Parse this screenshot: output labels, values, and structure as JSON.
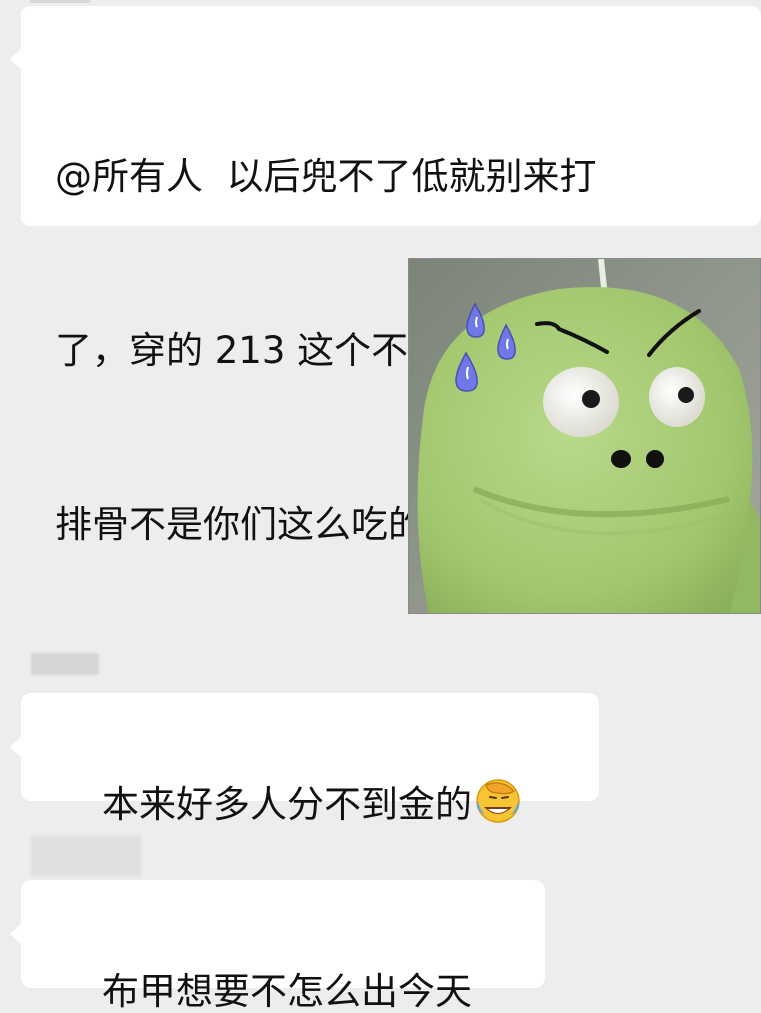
{
  "chat": {
    "messages": [
      {
        "side": "left",
        "type": "text",
        "sender": "",
        "lines": [
          "@所有人  以后兜不了低就别来打",
          "了，穿的 213 这个不要那个不要，",
          "排骨不是你们这么吃的。"
        ]
      },
      {
        "side": "right",
        "type": "sticker",
        "sticker_name": "green-frog-sweat-sticker"
      },
      {
        "side": "left",
        "type": "text",
        "sender": "",
        "text": "本来好多人分不到金的",
        "emoji": "face-with-tears-of-joy-facepalm"
      },
      {
        "side": "left",
        "type": "text",
        "sender": "",
        "text": "布甲想要不怎么出今天"
      }
    ]
  },
  "colors": {
    "background": "#ededed",
    "bubble": "#ffffff",
    "text": "#111111",
    "sticker_green": "#a7cc72",
    "sweat_drop": "#6f78e6"
  }
}
